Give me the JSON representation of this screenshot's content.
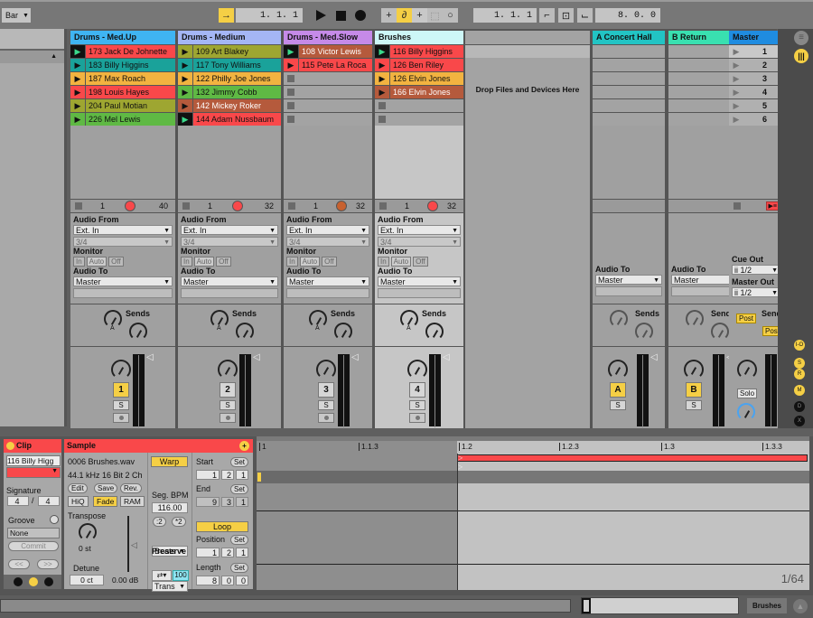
{
  "topbar": {
    "quantize": "Bar",
    "arrangement_position": "1.  1.  1",
    "loop_start": "1.  1.  1",
    "loop_length": "8.  0.  0",
    "icons": [
      "follow-icon",
      "play-icon",
      "stop-icon",
      "record-icon",
      "overdub-icon",
      "automation-arm-icon",
      "back-to-arrangement-icon",
      "capture-icon",
      "session-record-icon",
      "punch-in-icon",
      "loop-switch-icon",
      "punch-out-icon"
    ]
  },
  "tracks": [
    {
      "name": "Drums - Med.Up",
      "color": "#3fb4f2",
      "clips": [
        {
          "name": "173 Jack De Johnette",
          "color": "#f9484a",
          "playing": true
        },
        {
          "name": "183 Billy Higgins",
          "color": "#1aa29a"
        },
        {
          "name": "187 Max Roach",
          "color": "#f2b340"
        },
        {
          "name": "198 Louis Hayes",
          "color": "#f9484a"
        },
        {
          "name": "204 Paul Motian",
          "color": "#9ea631"
        },
        {
          "name": "226 Mel Lewis",
          "color": "#5fb944"
        }
      ],
      "stop": "1",
      "rec_color": "#f9484a",
      "tempo": "40",
      "audio_from": "Ext. In",
      "channel": "3/4",
      "monitor": [
        "In",
        "Auto",
        "Off"
      ],
      "audio_to": "Master",
      "number": "1",
      "number_on": true,
      "solo": "S"
    },
    {
      "name": "Drums - Medium",
      "color": "#a4b6f5",
      "clips": [
        {
          "name": "109 Art Blakey",
          "color": "#9ea631"
        },
        {
          "name": "117 Tony Williams",
          "color": "#1aa29a"
        },
        {
          "name": "122 Philly Joe Jones",
          "color": "#f2b340"
        },
        {
          "name": "132 Jimmy Cobb",
          "color": "#5fb944"
        },
        {
          "name": "142 Mickey Roker",
          "color": "#b55a3c",
          "light": true
        },
        {
          "name": "144 Adam Nussbaum",
          "color": "#f9484a",
          "playing": true
        }
      ],
      "stop": "1",
      "rec_color": "#f9484a",
      "tempo": "32",
      "audio_from": "Ext. In",
      "channel": "3/4",
      "monitor": [
        "In",
        "Auto",
        "Off"
      ],
      "audio_to": "Master",
      "number": "2",
      "number_on": false,
      "solo": "S"
    },
    {
      "name": "Drums - Med.Slow",
      "color": "#c58ae8",
      "clips": [
        {
          "name": "108 Victor Lewis",
          "color": "#b55a3c",
          "playing": true,
          "light": true
        },
        {
          "name": "115 Pete La Roca",
          "color": "#f9484a"
        }
      ],
      "stop": "1",
      "rec_color": "#c8612f",
      "tempo": "32",
      "audio_from": "Ext. In",
      "channel": "3/4",
      "monitor": [
        "In",
        "Auto",
        "Off"
      ],
      "audio_to": "Master",
      "number": "3",
      "number_on": false,
      "solo": "S"
    },
    {
      "name": "Brushes",
      "color": "#cdf7f7",
      "clips": [
        {
          "name": "116 Billy Higgins",
          "color": "#f9484a",
          "playing": true
        },
        {
          "name": "126 Ben Riley",
          "color": "#f9484a"
        },
        {
          "name": "126 Elvin Jones",
          "color": "#f2b340"
        },
        {
          "name": "166 Elvin Jones",
          "color": "#b55a3c",
          "light": true
        }
      ],
      "stop": "1",
      "rec_color": "#f9484a",
      "tempo": "32",
      "audio_from": "Ext. In",
      "channel": "3/4",
      "monitor": [
        "In",
        "Auto",
        "Off"
      ],
      "audio_to": "Master",
      "number": "4",
      "number_on": false,
      "solo": "S"
    }
  ],
  "drop_zone": "Drop Files and Devices Here",
  "returns": [
    {
      "name": "A Concert Hall",
      "color": "#22c4c4",
      "audio_to": "Master",
      "letter": "A",
      "solo": "S"
    },
    {
      "name": "B Return",
      "color": "#39e0b0",
      "audio_to": "Master",
      "letter": "B",
      "solo": "S"
    }
  ],
  "master": {
    "name": "Master",
    "color": "#1f8ce0",
    "scenes": [
      "1",
      "2",
      "3",
      "4",
      "5",
      "6"
    ],
    "cue_out_label": "Cue Out",
    "cue_out": "ii 1/2",
    "master_out_label": "Master Out",
    "master_out": "ii 1/2",
    "post": "Post",
    "solo": "Solo"
  },
  "labels": {
    "audio_from": "Audio From",
    "monitor": "Monitor",
    "audio_to": "Audio To",
    "sends": "Sends",
    "send_a": "A",
    "send_b": "B"
  },
  "right_toggles": [
    "I-O",
    "S",
    "R",
    "M",
    "D",
    "X"
  ],
  "clip_panel": {
    "title": "Clip",
    "name": "116 Billy Higg",
    "signature_label": "Signature",
    "sig_num": "4",
    "sig_den": "4",
    "groove_label": "Groove",
    "groove": "None",
    "commit": "Commit",
    "prev": "<<",
    "next": ">>"
  },
  "sample_panel": {
    "title": "Sample",
    "file": "0006 Brushes.wav",
    "info": "44.1 kHz 16 Bit 2 Ch",
    "edit": "Edit",
    "save": "Save",
    "rev": "Rev.",
    "hiq": "HiQ",
    "fade": "Fade",
    "ram": "RAM",
    "transpose_label": "Transpose",
    "transpose": "0 st",
    "detune_label": "Detune",
    "detune": "0 ct",
    "gain": "0.00 dB",
    "warp": "Warp",
    "seg_bpm_label": "Seg. BPM",
    "seg_bpm": "116.00",
    "half": ":2",
    "double": "*2",
    "warp_mode": "Beats",
    "preserve_label": "Preserve",
    "preserve": "Trans",
    "envelope": "100",
    "start_label": "Start",
    "start": [
      "1",
      "2",
      "1"
    ],
    "end_label": "End",
    "end": [
      "9",
      "3",
      "1"
    ],
    "set": "Set",
    "loop": "Loop",
    "position_label": "Position",
    "position": [
      "1",
      "2",
      "1"
    ],
    "length_label": "Length",
    "length": [
      "8",
      "0",
      "0"
    ]
  },
  "waveform": {
    "ruler": [
      "1",
      "1.1.3",
      "1.2",
      "1.2.3",
      "1.3",
      "1.3.3"
    ],
    "grid": "1/64"
  },
  "statusbar": {
    "track": "Brushes"
  }
}
